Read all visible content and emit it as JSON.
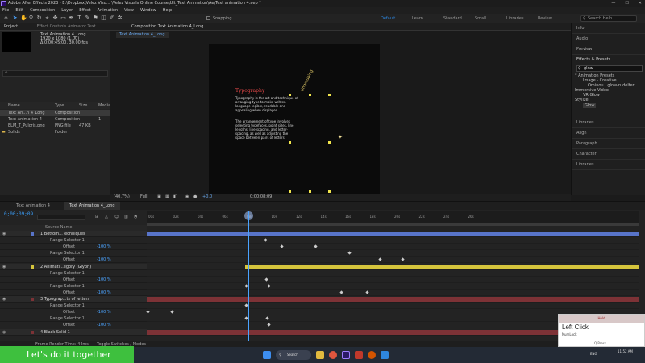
{
  "titlebar": {
    "text": "Adobe After Effects 2023 - E:\\Dropbox\\Velez Visu... \\Velez Visuals Online Course\\Ult_Text Animation\\Ae\\Text animation 4.aep *",
    "controls": [
      "—",
      "☐",
      "✕"
    ]
  },
  "menu": [
    "File",
    "Edit",
    "Composition",
    "Layer",
    "Effect",
    "Animation",
    "View",
    "Window",
    "Help"
  ],
  "toolbar": {
    "snapping": "Snapping",
    "workspaces": [
      "Default",
      "Learn",
      "Standard",
      "Small Screen",
      "Libraries",
      "Review"
    ],
    "active_workspace": "Default",
    "search_placeholder": "Search Help"
  },
  "project": {
    "tabs": [
      "Project",
      "Effect Controls Animator Text"
    ],
    "info": [
      "Text Animation 4_Long",
      "1920 x 1080 (1.00)",
      "Δ 0;00;45;00, 30.00 fps"
    ],
    "columns": [
      "Name",
      "Type",
      "Size",
      "Media"
    ],
    "items": [
      {
        "name": "Text An...n 4_Long",
        "type": "Composition",
        "size": "",
        "media": ""
      },
      {
        "name": "Text Animation 4",
        "type": "Composition",
        "size": "",
        "media": "1"
      },
      {
        "name": "ELM_T_Pulcris.png",
        "type": "PNG file",
        "size": "47 KB",
        "media": ""
      },
      {
        "name": "Solids",
        "type": "Folder",
        "size": "",
        "media": ""
      }
    ]
  },
  "composition": {
    "tab": "Composition Text Animation 4_Long",
    "subtab": "Text Animation 4_Long",
    "typo_title": "Typography",
    "paragraph1": "Typography is the art and technique of arranging type to make written language legible, readable and appealing when displayed",
    "paragraph2": "The arrangement of type involves selecting typefaces, point sizes, line lengths, line-spacing, and letter-spacing, as well as adjusting the space between pairs of letters.",
    "rotated_word": "Ungrouping",
    "controls": {
      "zoom": "(40.7%)",
      "quality": "Full",
      "plus": "+0.0",
      "timecode": "0;00;08;09"
    }
  },
  "right_panel": {
    "rows": [
      "Info",
      "Audio",
      "Preview",
      "Effects & Presets",
      "Libraries",
      "Align",
      "Paragraph",
      "Character",
      "Libraries"
    ],
    "effects_search": "glow",
    "effects_tree": [
      "* Animation Presets",
      "Image - Creative",
      "Ominou...glow-rudolfer",
      "Immersive Video",
      "VR Glow",
      "Stylize",
      "Glow"
    ]
  },
  "timeline": {
    "tabs": [
      "Text Animation 4",
      "Text Animation 4_Long"
    ],
    "timecode": "0;00;09;09",
    "column_head": "Source Name",
    "ruler": [
      "00s",
      "02s",
      "04s",
      "06s",
      "08s",
      "10s",
      "12s",
      "14s",
      "16s",
      "18s",
      "20s",
      "22s",
      "24s",
      "26s"
    ],
    "rows": [
      {
        "label": "1  Bottom...Techniques",
        "layer": true
      },
      {
        "label": "Range Selector 1",
        "layer": false
      },
      {
        "label": "Offset",
        "value": "-100 %",
        "layer": false
      },
      {
        "label": "Range Selector 1",
        "layer": false
      },
      {
        "label": "Offset",
        "value": "-100 %",
        "layer": false
      },
      {
        "label": "2  Animati...egory (Glyph)",
        "layer": true
      },
      {
        "label": "Range Selector 1",
        "layer": false
      },
      {
        "label": "Offset",
        "value": "-100 %",
        "layer": false
      },
      {
        "label": "Range Selector 1",
        "layer": false
      },
      {
        "label": "Offset",
        "value": "-100 %",
        "layer": false
      },
      {
        "label": "3  Typograp...ts of letters",
        "layer": true
      },
      {
        "label": "Range Selector 1",
        "layer": false
      },
      {
        "label": "Offset",
        "value": "-100 %",
        "layer": false
      },
      {
        "label": "Range Selector 1",
        "layer": false
      },
      {
        "label": "Offset",
        "value": "-100 %",
        "layer": false
      },
      {
        "label": "4  Black Solid 1",
        "layer": true
      }
    ],
    "status": {
      "render_time": "Frame Render Time: 44ms",
      "toggle": "Toggle Switches / Modes"
    }
  },
  "overlay": {
    "header": "Hold",
    "title": "Left Click",
    "subtitle": "NumLock",
    "footer": "Q Press"
  },
  "banner": "Let's do it together",
  "taskbar": {
    "search": "Search",
    "lang": "ENG",
    "clock": "11:52 AM"
  },
  "colors": {
    "accent": "#2d8ceb",
    "timecode": "#3a9af2",
    "bar_blue": "#5874c9",
    "bar_yellow": "#d5c43c",
    "bar_red": "#7d3236",
    "banner": "#3ec03e"
  }
}
